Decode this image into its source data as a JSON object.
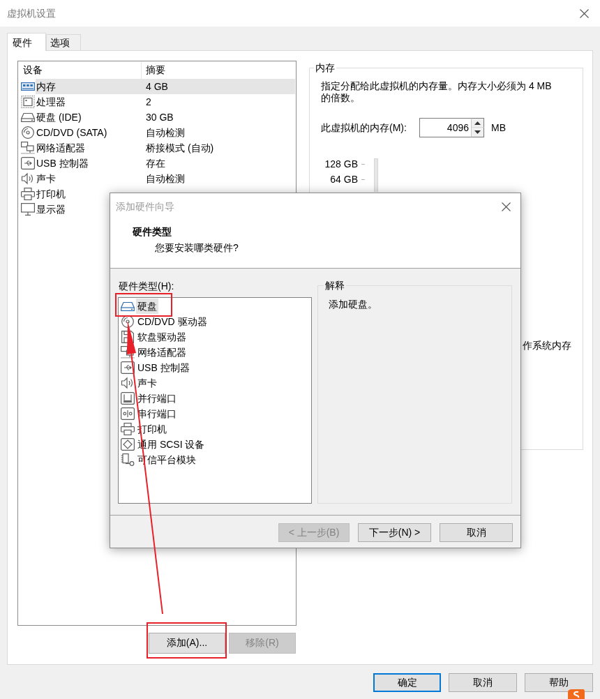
{
  "window": {
    "title": "虚拟机设置"
  },
  "tabs": [
    {
      "label": "硬件",
      "selected": true
    },
    {
      "label": "选项",
      "selected": false
    }
  ],
  "device_list": {
    "columns": [
      "设备",
      "摘要"
    ],
    "rows": [
      {
        "device": "内存",
        "summary": "4 GB",
        "kind": "memory",
        "selected": true
      },
      {
        "device": "处理器",
        "summary": "2",
        "kind": "cpu",
        "selected": false
      },
      {
        "device": "硬盘 (IDE)",
        "summary": "30 GB",
        "kind": "disk",
        "selected": false
      },
      {
        "device": "CD/DVD (SATA)",
        "summary": "自动检测",
        "kind": "cd",
        "selected": false
      },
      {
        "device": "网络适配器",
        "summary": "桥接模式 (自动)",
        "kind": "network",
        "selected": false
      },
      {
        "device": "USB 控制器",
        "summary": "存在",
        "kind": "usb",
        "selected": false
      },
      {
        "device": "声卡",
        "summary": "自动检测",
        "kind": "sound",
        "selected": false
      },
      {
        "device": "打印机",
        "kind": "printer",
        "selected": false
      },
      {
        "device": "显示器",
        "kind": "display",
        "selected": false
      }
    ]
  },
  "device_buttons": [
    {
      "label": "添加(A)...",
      "disabled": false,
      "annotated": true
    },
    {
      "label": "移除(R)",
      "disabled": true,
      "annotated": false
    }
  ],
  "memory_panel": {
    "title": "内存",
    "description": "指定分配给此虚拟机的内存量。内存大小必须为 4 MB 的倍数。",
    "field_label": "此虚拟机的内存(M):",
    "value": "4096",
    "unit": "MB",
    "scale_labels": [
      "128 GB",
      "64 GB"
    ],
    "note": "作系统内存"
  },
  "footer_buttons": [
    {
      "label": "确定",
      "default": true
    },
    {
      "label": "取消",
      "default": false
    },
    {
      "label": "帮助",
      "default": false
    }
  ],
  "dialog": {
    "title": "添加硬件向导",
    "heading": "硬件类型",
    "subheading": "您要安装哪类硬件?",
    "list_label": "硬件类型(H):",
    "items": [
      {
        "label": "硬盘",
        "kind": "disk",
        "selected": true,
        "annotated": true
      },
      {
        "label": "CD/DVD 驱动器",
        "kind": "cd",
        "selected": false,
        "annotated": false
      },
      {
        "label": "软盘驱动器",
        "kind": "floppy",
        "selected": false,
        "annotated": false
      },
      {
        "label": "网络适配器",
        "kind": "network",
        "selected": false,
        "annotated": false
      },
      {
        "label": "USB 控制器",
        "kind": "usb",
        "selected": false,
        "annotated": false
      },
      {
        "label": "声卡",
        "kind": "sound",
        "selected": false,
        "annotated": false
      },
      {
        "label": "并行端口",
        "kind": "parallel",
        "selected": false,
        "annotated": false
      },
      {
        "label": "串行端口",
        "kind": "serial",
        "selected": false,
        "annotated": false
      },
      {
        "label": "打印机",
        "kind": "printer",
        "selected": false,
        "annotated": false
      },
      {
        "label": "通用 SCSI 设备",
        "kind": "scsi",
        "selected": false,
        "annotated": false
      },
      {
        "label": "可信平台模块",
        "kind": "tpm",
        "selected": false,
        "annotated": false
      }
    ],
    "explanation": {
      "title": "解释",
      "text": "添加硬盘。"
    },
    "buttons": [
      {
        "label": "< 上一步(B)",
        "disabled": true
      },
      {
        "label": "下一步(N) >",
        "disabled": false
      },
      {
        "label": "取消",
        "disabled": false
      }
    ]
  }
}
